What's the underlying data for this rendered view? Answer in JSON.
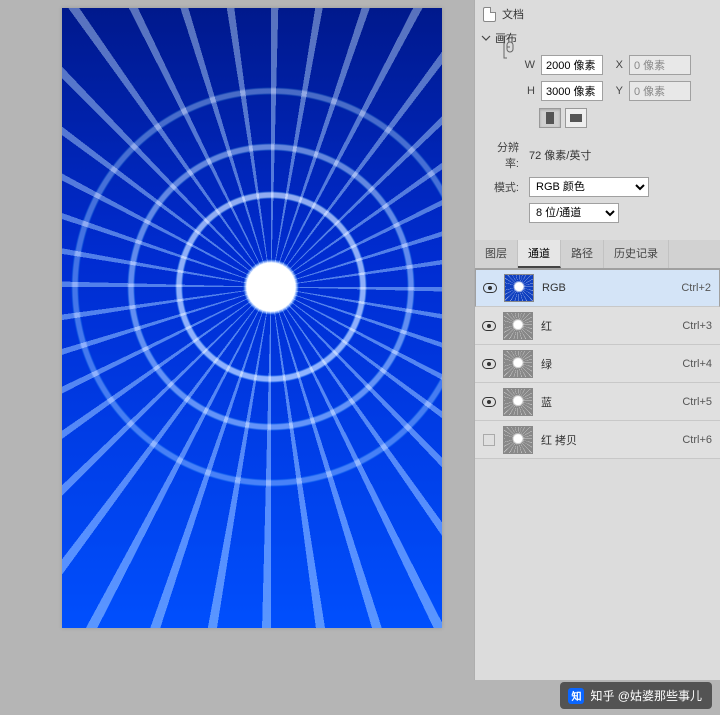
{
  "document_header_label": "文档",
  "section": {
    "title": "画布"
  },
  "canvas": {
    "w_label": "W",
    "w_value": "2000 像素",
    "h_label": "H",
    "h_value": "3000 像素",
    "x_label": "X",
    "x_value": "0 像素",
    "y_label": "Y",
    "y_value": "0 像素",
    "resolution_label": "分辨率:",
    "resolution_value": "72 像素/英寸",
    "mode_label": "模式:",
    "mode_value": "RGB 颜色",
    "bits_value": "8 位/通道"
  },
  "tabs": [
    "图层",
    "通道",
    "路径",
    "历史记录"
  ],
  "active_tab": 1,
  "channels": [
    {
      "name": "RGB",
      "shortcut": "Ctrl+2",
      "visible": true,
      "selected": true,
      "color": true
    },
    {
      "name": "红",
      "shortcut": "Ctrl+3",
      "visible": true,
      "selected": false,
      "color": false
    },
    {
      "name": "绿",
      "shortcut": "Ctrl+4",
      "visible": true,
      "selected": false,
      "color": false
    },
    {
      "name": "蓝",
      "shortcut": "Ctrl+5",
      "visible": true,
      "selected": false,
      "color": false
    },
    {
      "name": "红 拷贝",
      "shortcut": "Ctrl+6",
      "visible": false,
      "selected": false,
      "color": false
    }
  ],
  "watermark": {
    "logo_text": "知",
    "text": "知乎 @姑婆那些事儿"
  }
}
